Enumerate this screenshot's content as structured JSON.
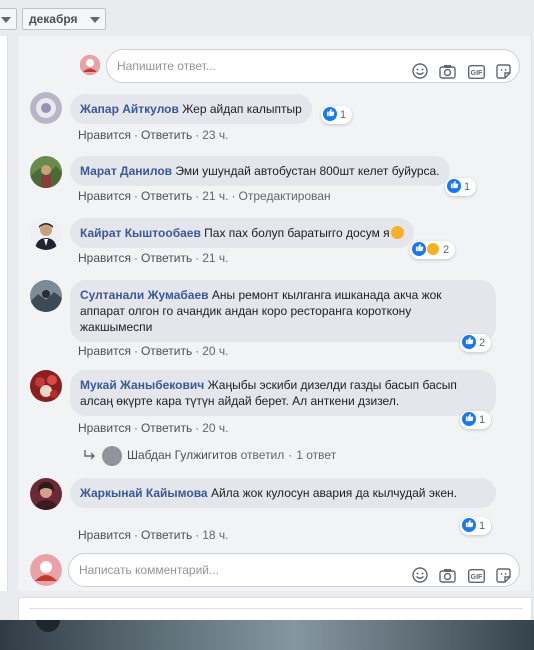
{
  "header": {
    "left_select_value": "",
    "month_select_value": "декабря"
  },
  "reply_input": {
    "placeholder": "Напишите ответ..."
  },
  "comments": [
    {
      "author": "Жапар Айткулов",
      "text": "Жер айдап калыптыр",
      "like_label": "Нравится",
      "reply_label": "Ответить",
      "time": "23 ч.",
      "edited": "",
      "reaction_count": "1"
    },
    {
      "author": "Марат Данилов",
      "text": "Эми ушундай автобустан 800шт келет буйурса.",
      "like_label": "Нравится",
      "reply_label": "Ответить",
      "time": "21 ч.",
      "edited": "Отредактирован",
      "reaction_count": "1"
    },
    {
      "author": "Кайрат Кыштообаев",
      "text": "Пах пах болуп баратыrго досум я",
      "like_label": "Нравится",
      "reply_label": "Ответить",
      "time": "21 ч.",
      "edited": "",
      "reaction_count": "2"
    },
    {
      "author": "Султанали Жумабаев",
      "text": "Аны ремонт кылганга ишканада акча жок аппарат олгон го ачандик андан коро ресторанга короткону жакшымеспи",
      "like_label": "Нравится",
      "reply_label": "Ответить",
      "time": "20 ч.",
      "edited": "",
      "reaction_count": "2"
    },
    {
      "author": "Мукай Жаныбекович",
      "text": "Жаңыбы эскиби дизелди газды басып басып алсаң өкүрте кара түтүн айдай берет. Ал анткени дзизел.",
      "like_label": "Нравится",
      "reply_label": "Ответить",
      "time": "20 ч.",
      "edited": "",
      "reaction_count": "1"
    },
    {
      "author": "Жаркынай Кайымова",
      "text": "Айла жок кулосун авария да кылчудай экен.",
      "like_label": "Нравится",
      "reply_label": "Ответить",
      "time": "18 ч.",
      "edited": "",
      "reaction_count": "1"
    }
  ],
  "reply_thread": {
    "author": "Шабдан Гулжигитов",
    "action": "ответил",
    "count": "1 ответ"
  },
  "comment_input": {
    "placeholder": "Написать комментарий..."
  },
  "colors": {
    "link": "#385898",
    "like_blue": "#1877f2",
    "bubble": "#e4e6eb",
    "haha_yellow": "#f7b125"
  },
  "icons": {
    "emoji": "smiley-icon",
    "camera": "camera-icon",
    "gif": "gif-icon",
    "sticker": "sticker-icon",
    "like": "thumbs-up-icon",
    "reply_arrow": "reply-arrow-icon"
  }
}
